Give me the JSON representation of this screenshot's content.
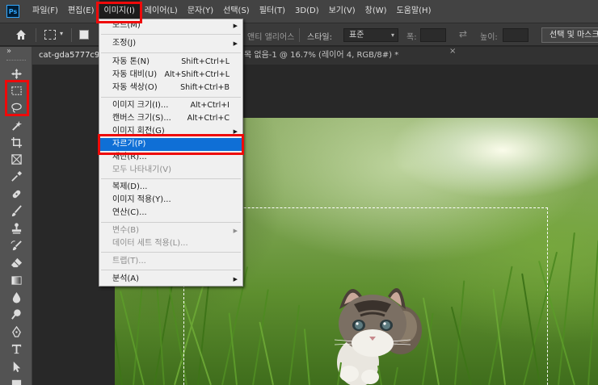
{
  "app": {
    "logo": "Ps"
  },
  "menubar": {
    "items": [
      {
        "label": "파일(F)"
      },
      {
        "label": "편집(E)"
      },
      {
        "label": "이미지(I)",
        "active": true
      },
      {
        "label": "레이어(L)"
      },
      {
        "label": "문자(Y)"
      },
      {
        "label": "선택(S)"
      },
      {
        "label": "필터(T)"
      },
      {
        "label": "3D(D)"
      },
      {
        "label": "보기(V)"
      },
      {
        "label": "창(W)"
      },
      {
        "label": "도움말(H)"
      }
    ]
  },
  "options": {
    "antialias": "앤티 앨리어스",
    "style_label": "스타일:",
    "style_value": "표준",
    "width_label": "폭:",
    "height_label": "높이:",
    "select_mask_button": "선택 및 마스크..."
  },
  "tabs": {
    "tab1": "cat-gda5777c9c_",
    "tab2": "목 없음-1 @ 16.7% (레이어 4, RGB/8#) *"
  },
  "image_menu": {
    "items": [
      {
        "label": "모드(M)",
        "submenu": true
      },
      {
        "label": "조정(J)",
        "submenu": true
      },
      {
        "label": "자동 톤(N)",
        "shortcut": "Shift+Ctrl+L"
      },
      {
        "label": "자동 대비(U)",
        "shortcut": "Alt+Shift+Ctrl+L"
      },
      {
        "label": "자동 색상(O)",
        "shortcut": "Shift+Ctrl+B"
      },
      {
        "label": "이미지 크기(I)...",
        "shortcut": "Alt+Ctrl+I"
      },
      {
        "label": "캔버스 크기(S)...",
        "shortcut": "Alt+Ctrl+C"
      },
      {
        "label": "이미지 회전(G)",
        "submenu": true
      },
      {
        "label": "자르기(P)",
        "selected": true
      },
      {
        "label": "재단(R)..."
      },
      {
        "label": "모두 나타내기(V)",
        "disabled": true
      },
      {
        "label": "복제(D)..."
      },
      {
        "label": "이미지 적용(Y)..."
      },
      {
        "label": "연산(C)..."
      },
      {
        "label": "변수(B)",
        "submenu": true,
        "disabled": true
      },
      {
        "label": "데이터 세트 적용(L)...",
        "disabled": true
      },
      {
        "label": "트랩(T)...",
        "disabled": true
      },
      {
        "label": "분석(A)",
        "submenu": true
      }
    ]
  },
  "colors": {
    "highlight_red": "#e01717",
    "menu_selected": "#0f6fd6",
    "app_bg": "#282828"
  }
}
